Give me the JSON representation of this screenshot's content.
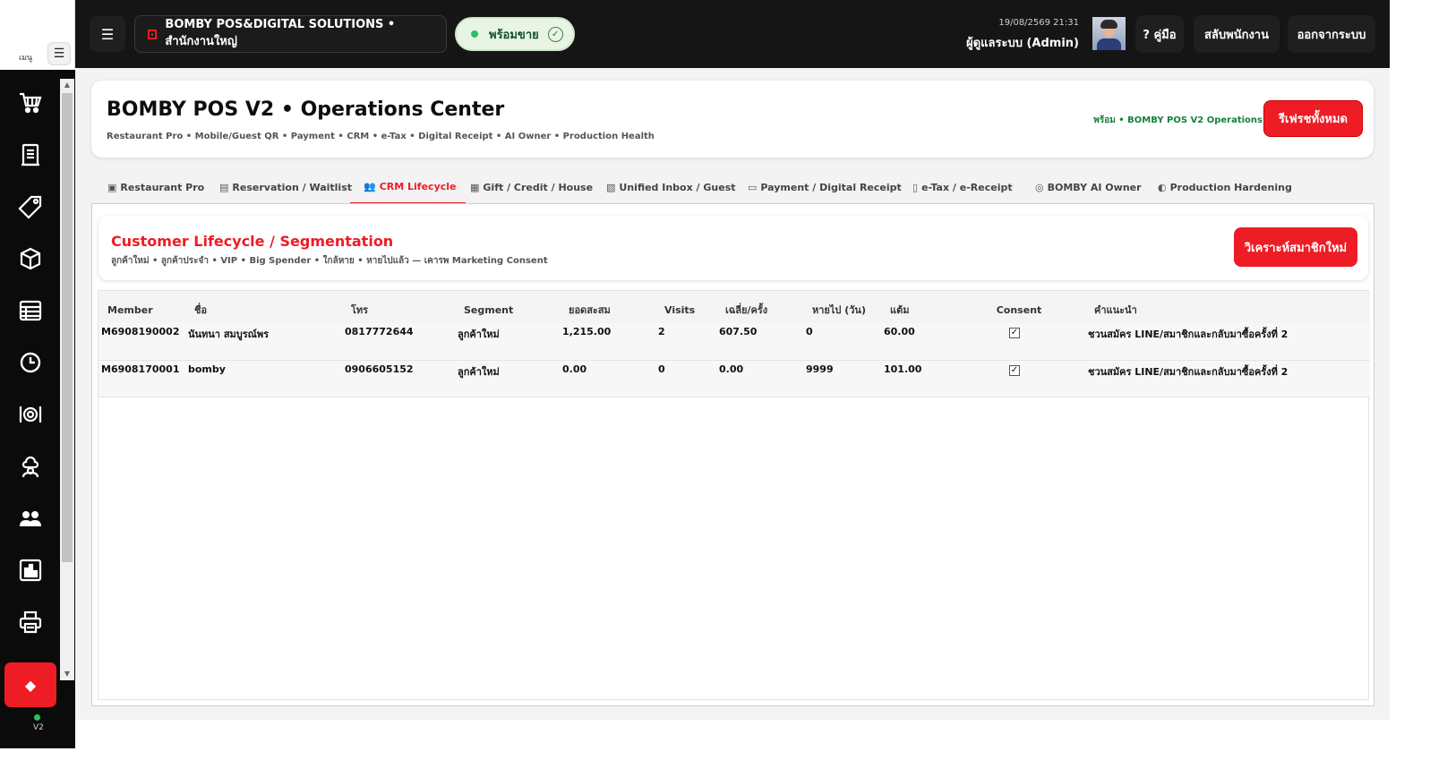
{
  "rail": {
    "menu_label": "เมนู",
    "version": "V2",
    "icons": [
      "cart-icon",
      "receipt-icon",
      "tag-icon",
      "box-icon",
      "table-icon",
      "clock-icon",
      "dish-icon",
      "chef-icon",
      "people-icon",
      "chart-icon",
      "printer-icon"
    ],
    "active_icon": "diamond-icon"
  },
  "topbar": {
    "menu_glyph": "☰",
    "store_name": "BOMBY POS&DIGITAL SOLUTIONS  •  สำนักงานใหญ่",
    "status_label": "พร้อมขาย",
    "date": "19/08/2569  21:31",
    "user": "ผู้ดูแลระบบ (Admin)",
    "guide_label": "? คู่มือ",
    "switch_label": "สลับพนักงาน",
    "logout_label": "ออกจากระบบ"
  },
  "header": {
    "title": "BOMBY POS V2 • Operations Center",
    "subtitle": "Restaurant Pro • Mobile/Guest QR • Payment • CRM • e-Tax • Digital Receipt • AI Owner • Production Health",
    "status": "พร้อม • BOMBY POS V2 Operations",
    "refresh_label": "รีเฟรชทั้งหมด"
  },
  "tabs": [
    {
      "label": "Restaurant Pro",
      "icon": "restaurant-icon",
      "glyph": "▣"
    },
    {
      "label": "Reservation / Waitlist",
      "icon": "calendar-icon",
      "glyph": "▤"
    },
    {
      "label": "CRM Lifecycle",
      "icon": "people-icon",
      "glyph": "👥"
    },
    {
      "label": "Gift / Credit / House",
      "icon": "gift-icon",
      "glyph": "▦"
    },
    {
      "label": "Unified Inbox / Guest",
      "icon": "inbox-icon",
      "glyph": "▧"
    },
    {
      "label": "Payment / Digital Receipt",
      "icon": "card-icon",
      "glyph": "▭"
    },
    {
      "label": "e-Tax / e-Receipt",
      "icon": "document-icon",
      "glyph": "▯"
    },
    {
      "label": "BOMBY AI Owner",
      "icon": "ai-icon",
      "glyph": "◎"
    },
    {
      "label": "Production Hardening",
      "icon": "shield-icon",
      "glyph": "◐"
    }
  ],
  "segment": {
    "title": "Customer Lifecycle / Segmentation",
    "subtitle": "ลูกค้าใหม่ • ลูกค้าประจำ • VIP • Big Spender • ใกล้หาย • หายไปแล้ว — เคารพ Marketing Consent",
    "analyze_label": "วิเคราะห์สมาชิกใหม่"
  },
  "table": {
    "columns": [
      "Member",
      "ชื่อ",
      "โทร",
      "Segment",
      "ยอดสะสม",
      "Visits",
      "เฉลี่ย/ครั้ง",
      "หายไป (วัน)",
      "แต้ม",
      "Consent",
      "คำแนะนำ"
    ],
    "rows": [
      {
        "member": "M6908190002",
        "name": "นันทนา สมบูรณ์พร",
        "phone": "0817772644",
        "segment": "ลูกค้าใหม่",
        "total": "1,215.00",
        "visits": "2",
        "avg": "607.50",
        "gone": "0",
        "points": "60.00",
        "consent": "✓",
        "advice": "ชวนสมัคร LINE/สมาชิกและกลับมาซื้อครั้งที่ 2"
      },
      {
        "member": "M6908170001",
        "name": "bomby",
        "phone": "0906605152",
        "segment": "ลูกค้าใหม่",
        "total": "0.00",
        "visits": "0",
        "avg": "0.00",
        "gone": "9999",
        "points": "101.00",
        "consent": "✓",
        "advice": "ชวนสมัคร LINE/สมาชิกและกลับมาซื้อครั้งที่ 2"
      }
    ]
  },
  "colors": {
    "accent": "#ee1c25",
    "ready_green": "#22c55e",
    "dark_bar": "#151515"
  }
}
